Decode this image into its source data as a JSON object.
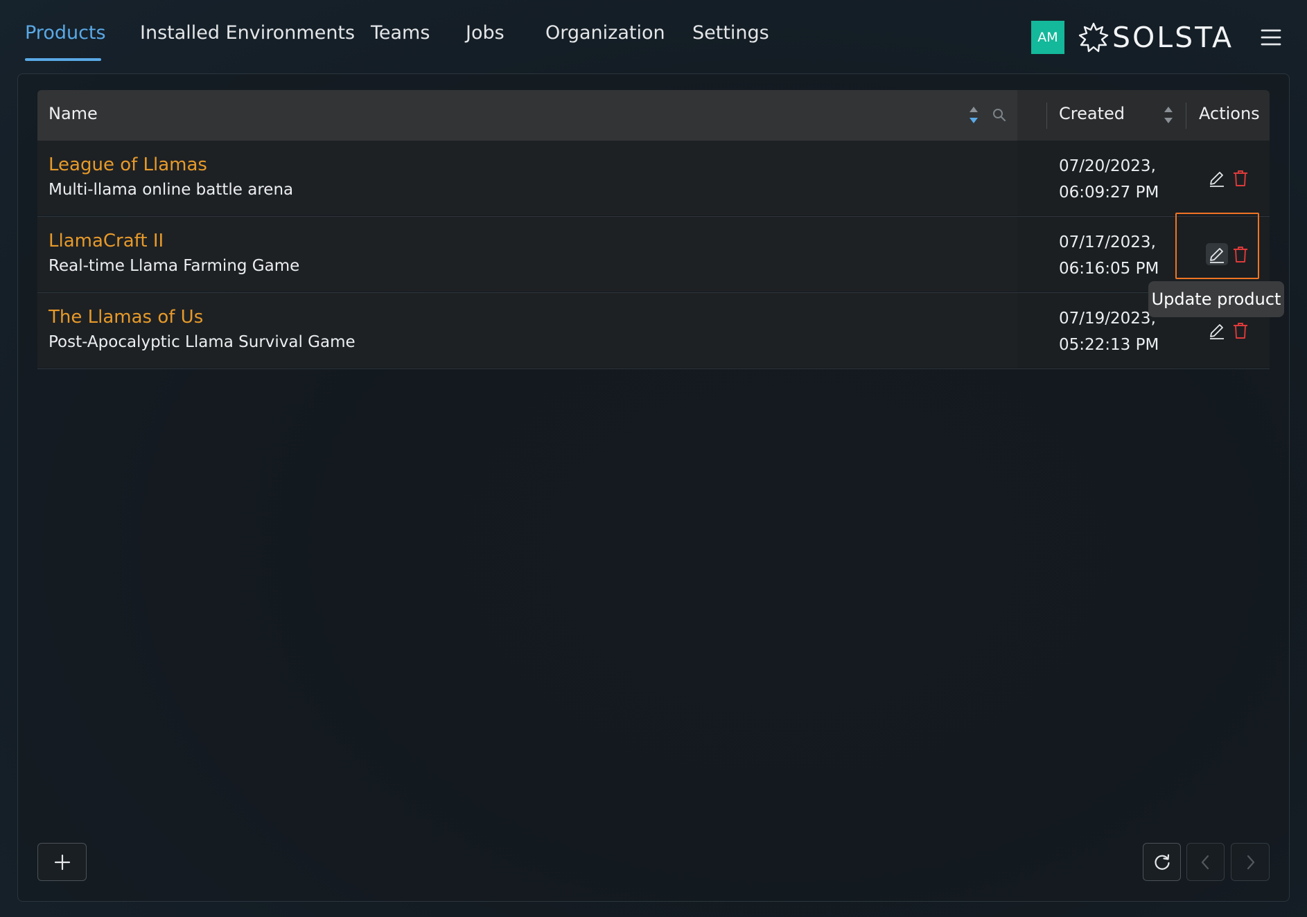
{
  "nav": {
    "tabs": [
      {
        "label": "Products",
        "active": true
      },
      {
        "label": "Installed Environments",
        "active": false
      },
      {
        "label": "Teams",
        "active": false
      },
      {
        "label": "Jobs",
        "active": false
      },
      {
        "label": "Organization",
        "active": false
      },
      {
        "label": "Settings",
        "active": false
      }
    ],
    "avatar_initials": "AM",
    "logo_text": "SOLSTA",
    "menu_icon": "hamburger-menu-icon"
  },
  "colors": {
    "accent": "#5aa9e6",
    "product_title": "#e79a2a",
    "avatar_bg": "#14b89a",
    "delete_icon": "#e03a3a",
    "highlight": "#f07424"
  },
  "table": {
    "columns": {
      "name": "Name",
      "created": "Created",
      "actions": "Actions"
    },
    "rows": [
      {
        "title": "League of Llamas",
        "description": "Multi-llama online battle arena",
        "created_date": "07/20/2023,",
        "created_time": "06:09:27 PM"
      },
      {
        "title": "LlamaCraft II",
        "description": "Real-time Llama Farming Game",
        "created_date": "07/17/2023,",
        "created_time": "06:16:05 PM"
      },
      {
        "title": "The Llamas of Us",
        "description": "Post-Apocalyptic Llama Survival Game",
        "created_date": "07/19/2023,",
        "created_time": "05:22:13 PM"
      }
    ]
  },
  "tooltip": {
    "text": "Update product"
  },
  "footer": {
    "add_icon": "plus-icon",
    "refresh_icon": "refresh-icon",
    "prev_icon": "chevron-left-icon",
    "next_icon": "chevron-right-icon"
  }
}
